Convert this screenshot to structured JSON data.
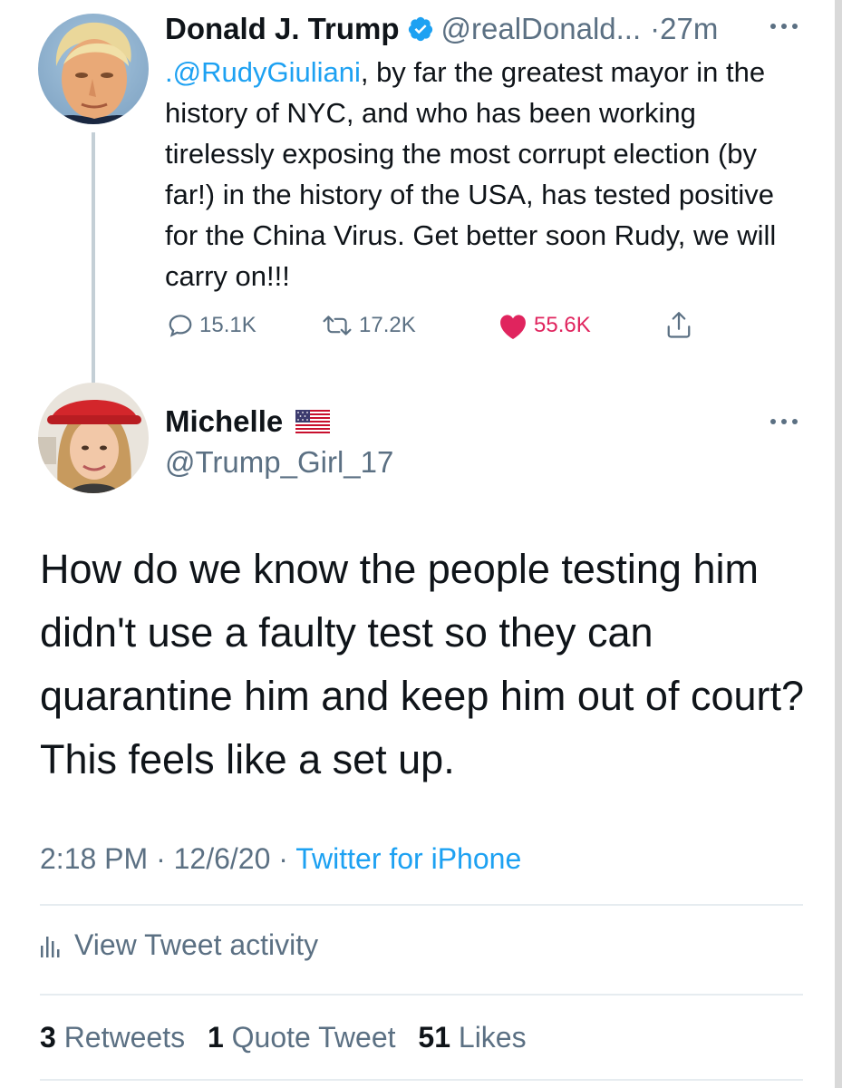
{
  "parent_tweet": {
    "author_name": "Donald J. Trump",
    "handle": "@realDonald...",
    "separator": "·",
    "time_ago": "27m",
    "mention": ".@RudyGiuliani",
    "body": ", by far the greatest mayor in the history of NYC, and who has been working tirelessly exposing the most corrupt election (by far!) in the history of the USA, has tested positive for the China Virus. Get better soon Rudy, we will carry on!!!",
    "replies_count": "15.1K",
    "retweets_count": "17.2K",
    "likes_count": "55.6K",
    "avatar_icon": "user-avatar",
    "verified_icon": "verified-badge-icon",
    "more_icon": "more-options-icon"
  },
  "reply_tweet": {
    "author_name": "Michelle",
    "flag_icon": "us-flag-icon",
    "handle": "@Trump_Girl_17",
    "body": "How do we know the people testing him didn't use a faulty test so they can quarantine him and keep him out of court? This feels like a set up.",
    "time": "2:18 PM",
    "date": "12/6/20",
    "separator": "·",
    "source": "Twitter for iPhone",
    "more_icon": "more-options-icon"
  },
  "activity": {
    "label": "View Tweet activity",
    "icon": "activity-bars-icon"
  },
  "stats": {
    "retweets_value": "3",
    "retweets_label": "Retweets",
    "quote_tweets_value": "1",
    "quote_tweets_label": "Quote Tweet",
    "likes_value": "51",
    "likes_label": "Likes"
  },
  "colors": {
    "text": "#0f1419",
    "muted": "#5b7083",
    "link": "#1da1f2",
    "like": "#e0245e",
    "divider": "#e6ecf0",
    "thread_line": "#c4cfd6"
  }
}
